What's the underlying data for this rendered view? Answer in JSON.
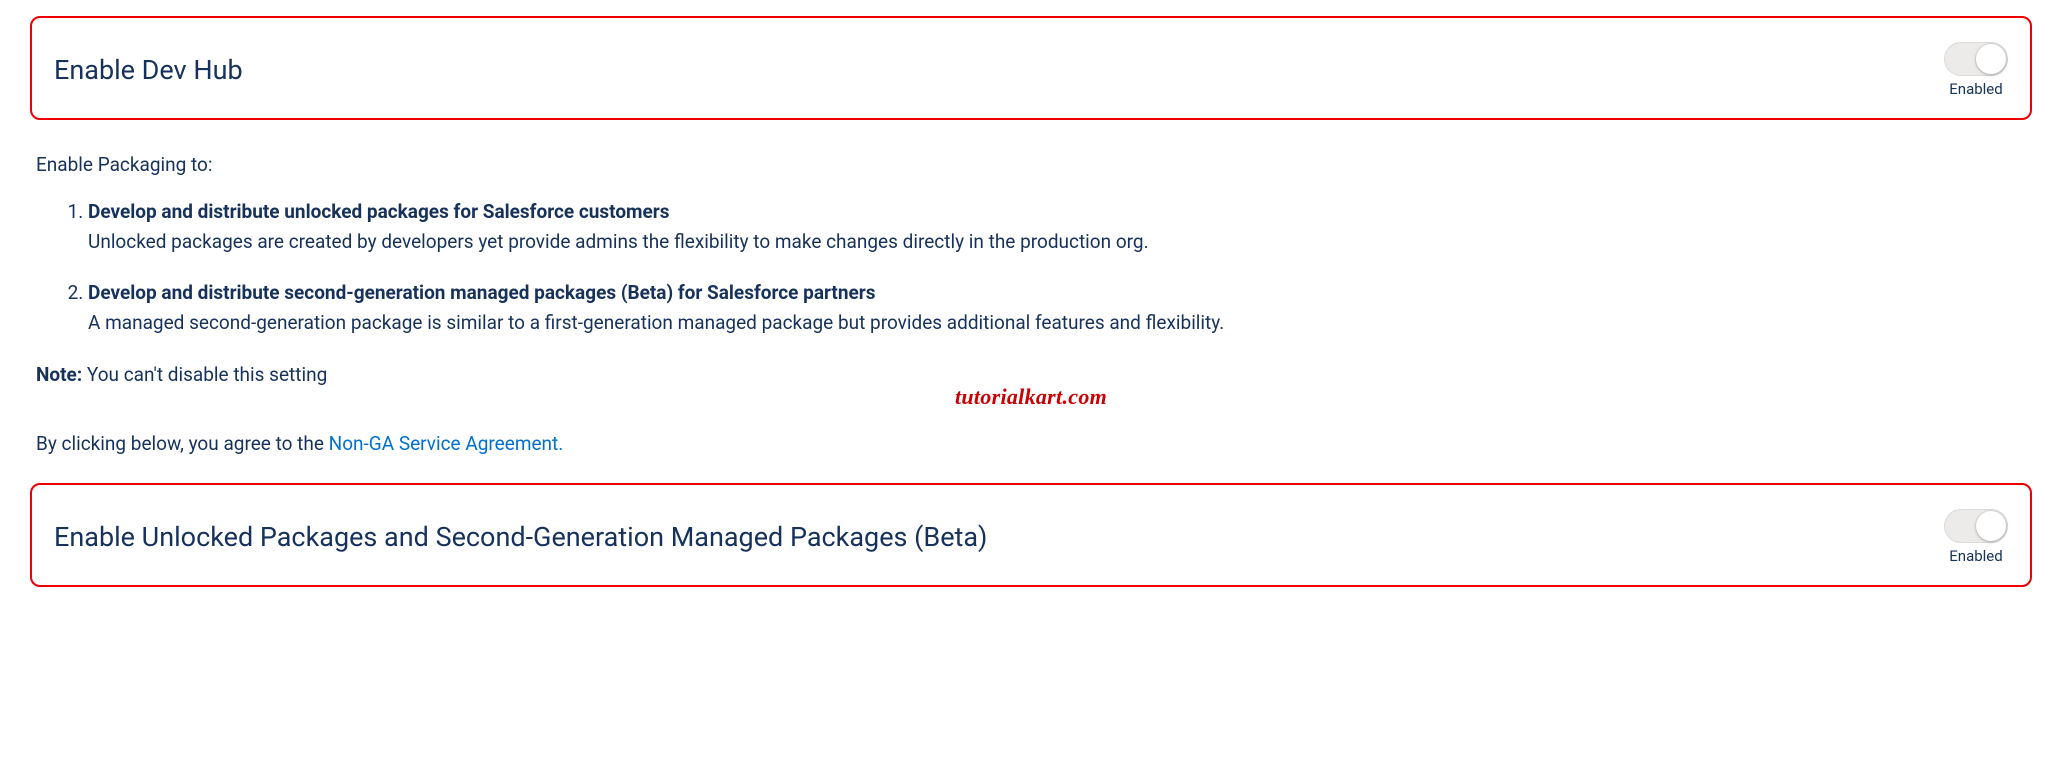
{
  "settings": {
    "devhub": {
      "title": "Enable Dev Hub",
      "toggle_state_label": "Enabled"
    },
    "packaging": {
      "title": "Enable Unlocked Packages and Second-Generation Managed Packages (Beta)",
      "toggle_state_label": "Enabled"
    }
  },
  "packaging_section": {
    "intro": "Enable Packaging to:",
    "items": [
      {
        "headline": "Develop and distribute unlocked packages for Salesforce customers",
        "desc": "Unlocked packages are created by developers yet provide admins the flexibility to make changes directly in the production org."
      },
      {
        "headline": "Develop and distribute second-generation managed packages (Beta) for Salesforce partners",
        "desc": "A managed second-generation package is similar to a first-generation managed package but provides additional features and flexibility."
      }
    ],
    "note_label": "Note:",
    "note_text": " You can't disable this setting",
    "agree_prefix": "By clicking below, you agree to the ",
    "agree_link": "Non-GA Service Agreement.",
    "watermark": "tutorialkart.com"
  }
}
